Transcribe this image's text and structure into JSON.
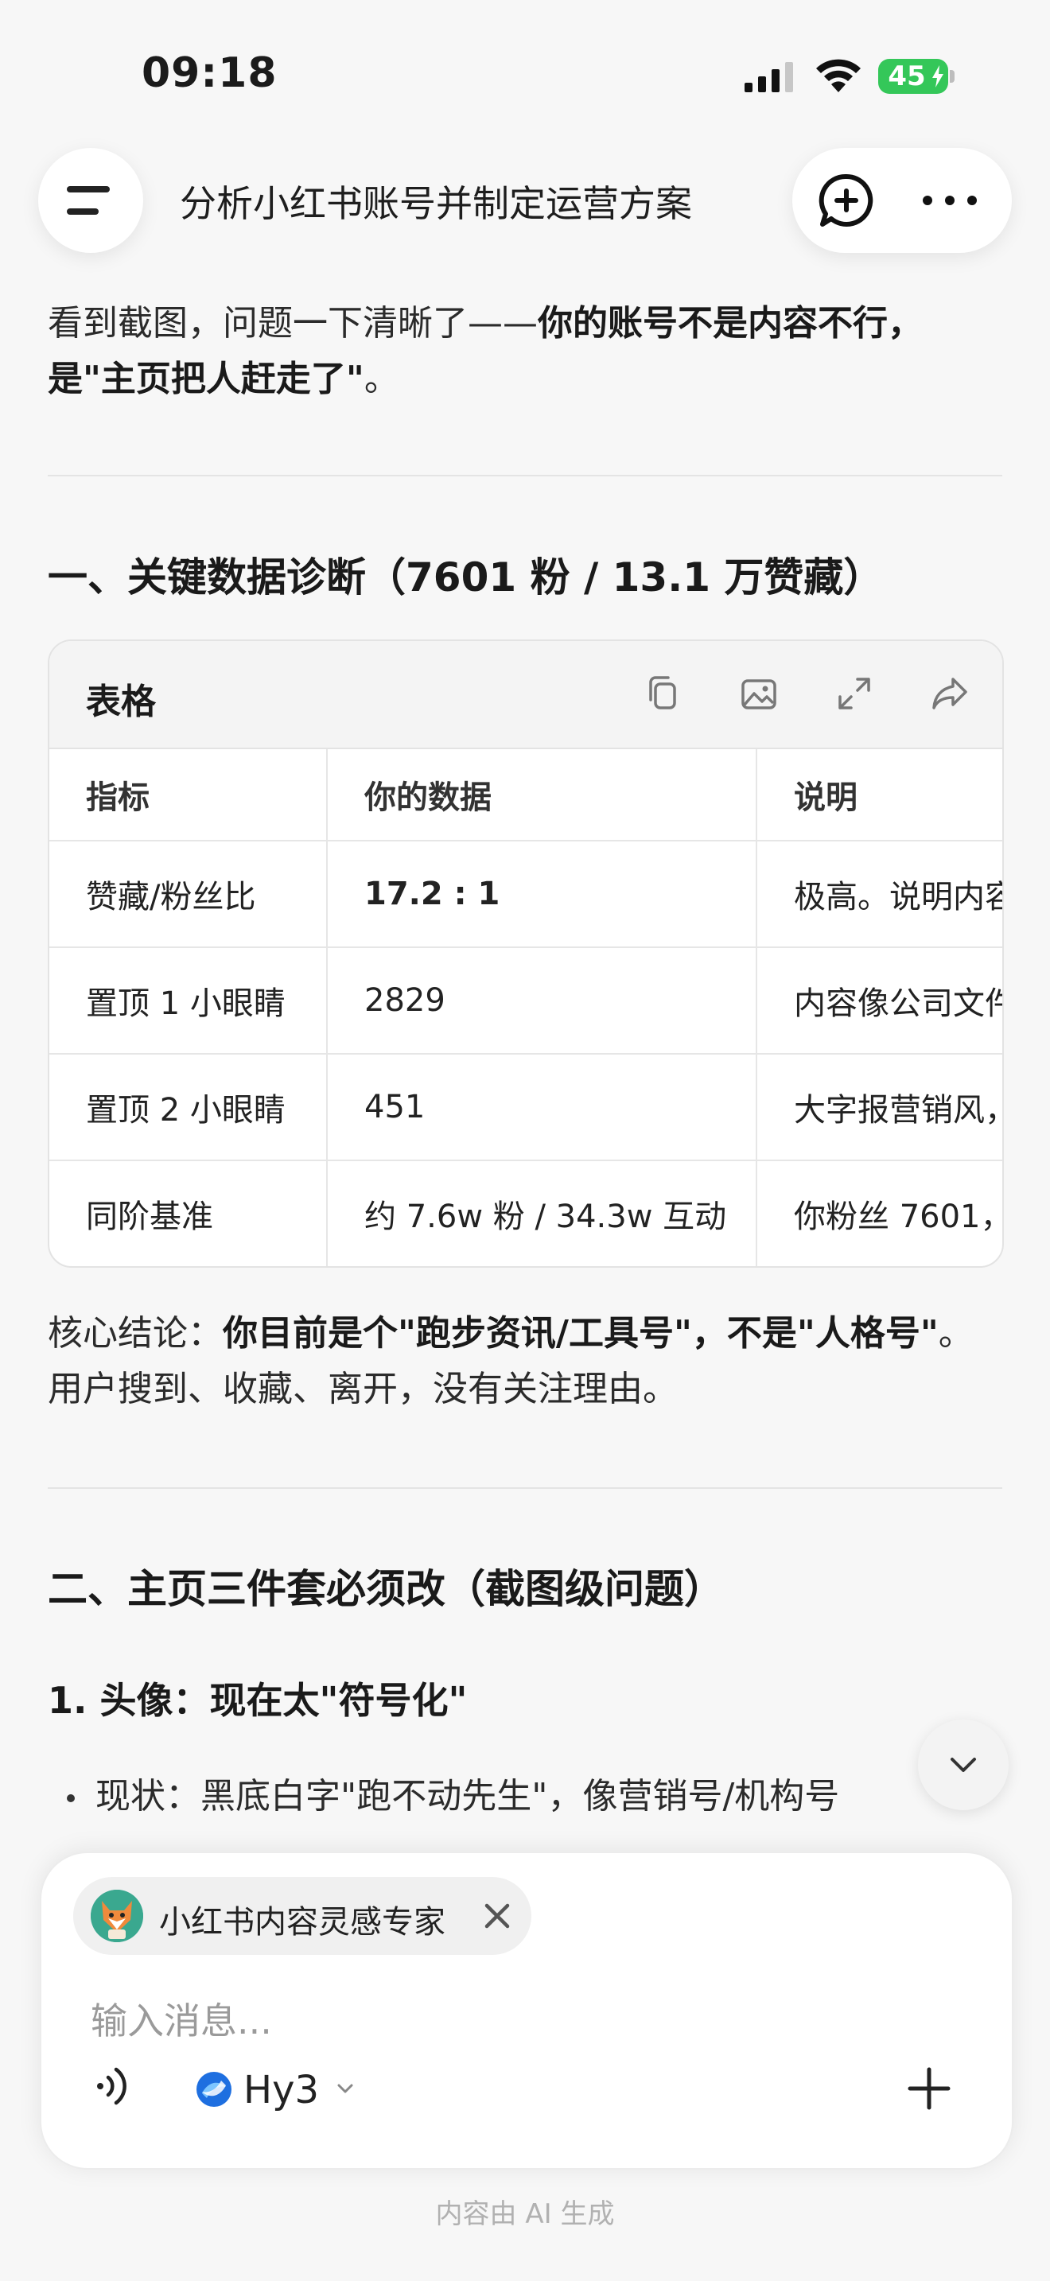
{
  "status_bar": {
    "time": "09:18",
    "battery": "45"
  },
  "header": {
    "title": "分析小红书账号并制定运营方案"
  },
  "intro": {
    "normal": "看到截图，问题一下清晰了——",
    "bold": "你的账号不是内容不行，是\"主页把人赶走了\"",
    "end": "。"
  },
  "section1": {
    "heading": "一、关键数据诊断（7601 粉 / 13.1 万赞藏）"
  },
  "table": {
    "label": "表格",
    "headers": [
      "指标",
      "你的数据",
      "说明"
    ],
    "rows": [
      [
        "赞藏/粉丝比",
        "17.2 : 1",
        "极高。说明内容"
      ],
      [
        "置顶 1 小眼睛",
        "2829",
        "内容像公司文件"
      ],
      [
        "置顶 2 小眼睛",
        "451",
        "大字报营销风，"
      ],
      [
        "同阶基准",
        "约 7.6w 粉 / 34.3w 互动",
        "你粉丝 7601，"
      ]
    ]
  },
  "conclusion": {
    "prefix": "核心结论：",
    "bold1": "你目前是个\"跑步资讯/工具号\"，不是\"人格号\"",
    "rest": "。用户搜到、收藏、离开，没有关注理由。"
  },
  "section2": {
    "heading": "二、主页三件套必须改（截图级问题）"
  },
  "subsection1": {
    "heading": "1. 头像：现在太\"符号化\""
  },
  "bullet1": "现状：黑底白字\"跑不动先生\"，像营销号/机构号",
  "composer": {
    "agent_name": "小红书内容灵感专家",
    "placeholder": "输入消息...",
    "model": "Hy3"
  },
  "footer": "内容由 AI 生成",
  "colors": {
    "battery": "#34c759",
    "model_logo": "#1e6fe0"
  }
}
